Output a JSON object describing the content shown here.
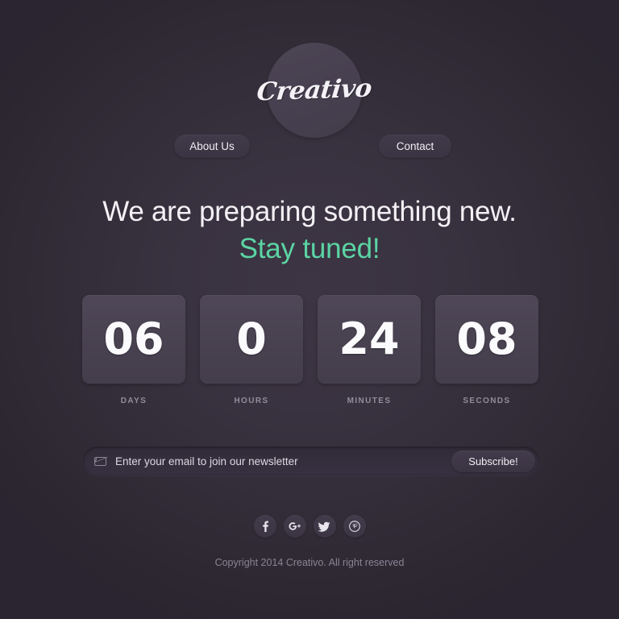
{
  "brand": {
    "logo_text": "Creativo",
    "circle_color": "#494251"
  },
  "nav": {
    "about_label": "About Us",
    "contact_label": "Contact"
  },
  "headline": {
    "line1": "We are preparing something new.",
    "line2": "Stay tuned!",
    "accent_color": "#5bd4a4"
  },
  "countdown": {
    "units": [
      {
        "value": "06",
        "label": "DAYS"
      },
      {
        "value": "0",
        "label": "HOURS"
      },
      {
        "value": "24",
        "label": "MINUTES"
      },
      {
        "value": "08",
        "label": "SECONDS"
      }
    ]
  },
  "newsletter": {
    "placeholder": "Enter your email to join our newsletter",
    "value": "",
    "subscribe_label": "Subscribe!",
    "icon": "envelope-icon"
  },
  "social": {
    "items": [
      {
        "name": "facebook",
        "glyph": "f"
      },
      {
        "name": "google-plus",
        "glyph": "g+"
      },
      {
        "name": "twitter",
        "glyph": "t"
      },
      {
        "name": "pinterest",
        "glyph": "p"
      }
    ]
  },
  "footer": {
    "copyright": "Copyright 2014 Creativo. All right reserved"
  },
  "theme": {
    "background": "#2e2933",
    "surface": "#494251",
    "text": "#f3f1f5",
    "muted": "#8a8394"
  }
}
